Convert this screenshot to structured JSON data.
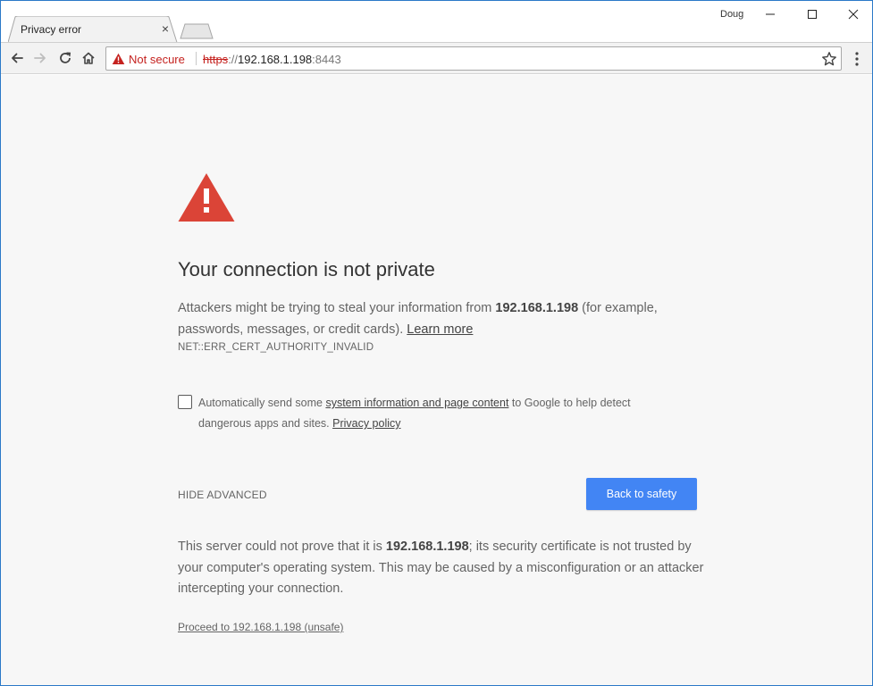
{
  "browser": {
    "tab_title": "Privacy error",
    "tab_close_symbol": "×",
    "user_name": "Doug"
  },
  "toolbar": {
    "not_secure_label": "Not secure",
    "url_scheme": "https",
    "url_separator": "://",
    "url_host": "192.168.1.198",
    "url_port": ":8443"
  },
  "content": {
    "heading": "Your connection is not private",
    "explanation_before": "Attackers might be trying to steal your information from ",
    "explanation_host": "192.168.1.198",
    "explanation_after": " (for example, passwords, messages, or credit cards). ",
    "learn_more": "Learn more",
    "error_code": "NET::ERR_CERT_AUTHORITY_INVALID",
    "checkbox_before": "Automatically send some ",
    "checkbox_link": "system information and page content",
    "checkbox_after": " to Google to help detect dangerous apps and sites. ",
    "privacy_policy": "Privacy policy",
    "hide_advanced": "HIDE ADVANCED",
    "back_to_safety": "Back to safety",
    "details_before": "This server could not prove that it is ",
    "details_host": "192.168.1.198",
    "details_after": "; its security certificate is not trusted by your computer's operating system. This may be caused by a misconfiguration or an attacker intercepting your connection.",
    "proceed_link": "Proceed to 192.168.1.198 (unsafe)"
  },
  "colors": {
    "warning_red": "#db4437",
    "button_blue": "#4285f4",
    "page_background": "#f7f7f7"
  },
  "icons": [
    "close-icon",
    "minimize-icon",
    "maximize-icon",
    "back-arrow-icon",
    "forward-arrow-icon",
    "reload-icon",
    "home-icon",
    "warning-icon",
    "star-icon",
    "menu-icon",
    "error-triangle-icon"
  ]
}
